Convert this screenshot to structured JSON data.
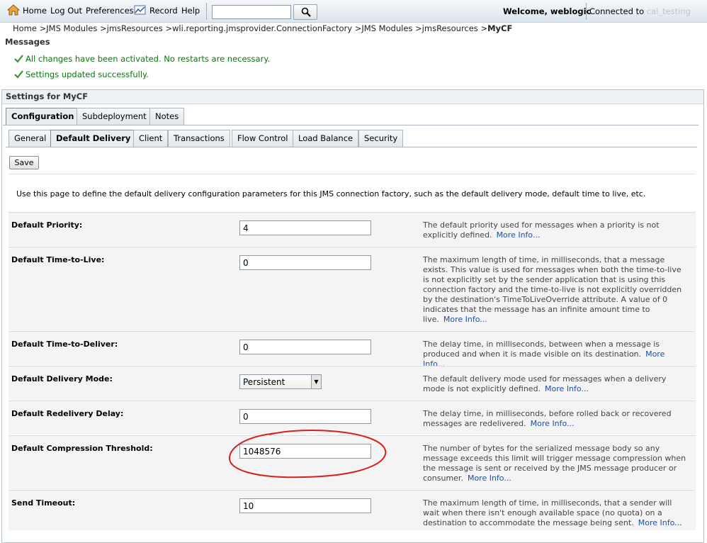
{
  "topbar": {
    "home": "Home",
    "logout": "Log Out",
    "preferences": "Preferences",
    "record": "Record",
    "help": "Help",
    "search_value": "",
    "welcome": "Welcome, weblogic",
    "connected_prefix": "Connected to",
    "connected_domain": "cal_testing"
  },
  "breadcrumb": {
    "path": "Home >JMS Modules >jmsResources >wli.reporting.jmsprovider.ConnectionFactory >JMS Modules >jmsResources >",
    "current": "MyCF"
  },
  "messages": {
    "title": "Messages",
    "items": [
      "All changes have been activated. No restarts are necessary.",
      "Settings updated successfully."
    ]
  },
  "settings": {
    "title": "Settings for MyCF",
    "primary_tabs": [
      "Configuration",
      "Subdeployment",
      "Notes"
    ],
    "secondary_tabs": [
      "General",
      "Default Delivery",
      "Client",
      "Transactions",
      "Flow Control",
      "Load Balance",
      "Security"
    ],
    "save_label": "Save",
    "intro": "Use this page to define the default delivery configuration parameters for this JMS connection factory, such as the default delivery mode, default time to live, etc."
  },
  "fields": [
    {
      "label": "Default Priority:",
      "value": "4",
      "help": "The default priority used for messages when a priority is not explicitly defined.",
      "more": "More Info..."
    },
    {
      "label": "Default Time-to-Live:",
      "value": "0",
      "help": "The maximum length of time, in milliseconds, that a message exists. This value is used for messages when both the time-to-live is not explicitly set by the sender application that is using this connection factory and the time-to-live is not explicitly overridden by the destination's TimeToLiveOverride attribute. A value of 0 indicates that the message has an infinite amount time to live.",
      "more": "More Info..."
    },
    {
      "label": "Default Time-to-Deliver:",
      "value": "0",
      "help": "The delay time, in milliseconds, between when a message is produced and when it is made visible on its destination.",
      "more": "More Info..."
    },
    {
      "label": "Default Delivery Mode:",
      "value": "Persistent",
      "help": "The default delivery mode used for messages when a delivery mode is not explicitly defined.",
      "more": "More Info..."
    },
    {
      "label": "Default Redelivery Delay:",
      "value": "0",
      "help": "The delay time, in milliseconds, before rolled back or recovered messages are redelivered.",
      "more": "More Info..."
    },
    {
      "label": "Default Compression Threshold:",
      "value": "1048576",
      "help": "The number of bytes for the serialized message body so any message exceeds this limit will trigger message compression when the message is sent or received by the JMS message producer or consumer.",
      "more": "More Info..."
    },
    {
      "label": "Send Timeout:",
      "value": "10",
      "help": "The maximum length of time, in milliseconds, that a sender will wait when there isn't enough available space (no quota) on a destination to accommodate the message being sent.",
      "more": "More Info..."
    }
  ],
  "colors": {
    "success": "#0a7a0a",
    "link": "#1f4fa8",
    "highlight": "#d42020"
  }
}
